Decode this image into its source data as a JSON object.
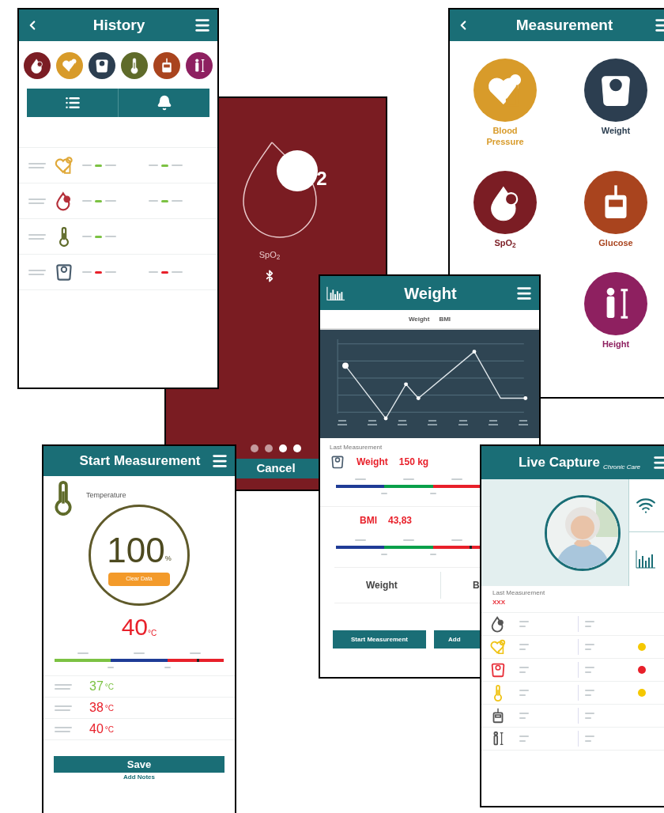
{
  "history": {
    "title": "History",
    "categories": [
      {
        "kind": "spo2",
        "color": "#7b1d24"
      },
      {
        "kind": "blood_pressure",
        "color": "#d89b2a"
      },
      {
        "kind": "weight",
        "color": "#2c3e50"
      },
      {
        "kind": "temperature",
        "color": "#5f6b2a"
      },
      {
        "kind": "glucose",
        "color": "#a9441e"
      },
      {
        "kind": "height",
        "color": "#8e2060"
      }
    ],
    "tabs": [
      {
        "kind": "list"
      },
      {
        "kind": "bell"
      }
    ],
    "rows": [
      {
        "kind": "blood_pressure",
        "icon": {
          "color": "#e0a93a"
        },
        "values": [
          {
            "color": "#7cc243"
          },
          {
            "color": "#7cc243"
          }
        ]
      },
      {
        "kind": "spo2",
        "icon": {
          "color": "#b5303a"
        },
        "values": [
          {
            "color": "#7cc243"
          },
          {
            "color": "#7cc243"
          }
        ]
      },
      {
        "kind": "temperature",
        "icon": {
          "color": "#5f6b2a"
        },
        "values": [
          {
            "color": "#7cc243"
          }
        ]
      },
      {
        "kind": "weight",
        "icon": {
          "color": "#4a5d6e"
        },
        "values": [
          {
            "color": "#e8202a"
          },
          {
            "color": "#e8202a"
          }
        ]
      }
    ]
  },
  "spo2": {
    "subscript": "2",
    "label": "SpO$_{2}$",
    "dots": [
      {
        "filled": false
      },
      {
        "filled": false
      },
      {
        "filled": true
      },
      {
        "filled": true
      }
    ],
    "cancel": "Cancel"
  },
  "measurement": {
    "title": "Measurement",
    "items": [
      {
        "kind": "blood_pressure",
        "label": "Blood Pressure",
        "color": "#d89b2a"
      },
      {
        "kind": "weight",
        "label": "Weight",
        "color": "#2c3e50"
      },
      {
        "kind": "spo2",
        "label": "SpO$_{2}$",
        "color": "#7b1d24"
      },
      {
        "kind": "glucose",
        "label": "Glucose",
        "color": "#a9441e"
      },
      {
        "kind": "height",
        "label": "Height",
        "color": "#8e2060"
      }
    ]
  },
  "weight": {
    "title": "Weight",
    "tabs": [
      "Weight",
      "BMI"
    ],
    "last_measurement": "Last Measurement",
    "weight_label": "Weight",
    "weight_value": "150 kg",
    "weight_scale": [
      {
        "color": "#1f3c96"
      },
      {
        "color": "#0aa04a"
      },
      {
        "color": "#e8202a"
      }
    ],
    "bmi_label": "BMI",
    "bmi_value": "43,83",
    "bmi_scale": [
      {
        "color": "#1f3c96"
      },
      {
        "color": "#0aa04a"
      },
      {
        "color": "#e8202a"
      }
    ],
    "bmi_marker": {
      "level": 0.92
    },
    "bottom_tabs": [
      "Weight",
      "B"
    ],
    "buttons": [
      "Start Measurement",
      "Add"
    ]
  },
  "start": {
    "title": "Start Measurement",
    "sensor": "Temperature",
    "progress": "100",
    "progress_unit": "%",
    "clear": "Clear Data",
    "reading": "40",
    "reading_unit": "°C",
    "scale": [
      {
        "color": "#7cc243"
      },
      {
        "color": "#1f3c96"
      },
      {
        "color": "#e8202a"
      }
    ],
    "marker": {
      "level": 0.84
    },
    "history": [
      {
        "value": "37",
        "unit": "°C",
        "color": "#7cc243"
      },
      {
        "value": "38",
        "unit": "°C",
        "color": "#e8202a"
      },
      {
        "value": "40",
        "unit": "°C",
        "color": "#e8202a"
      }
    ],
    "save": "Save",
    "notes": "Add Notes"
  },
  "live": {
    "title": "Live Capture",
    "logo": "Chronic Care",
    "last_measurement": "Last Measurement",
    "last_value": "XXX",
    "rows": [
      {
        "kind": "spo2",
        "icon": {
          "color": "#555555"
        }
      },
      {
        "kind": "blood_pressure",
        "icon": {
          "color": "#f0c419"
        },
        "color": "#f5c800"
      },
      {
        "kind": "weight",
        "icon": {
          "color": "#e8303a"
        },
        "color": "#e8202a"
      },
      {
        "kind": "temperature",
        "icon": {
          "color": "#f0c419"
        },
        "color": "#f5c800"
      },
      {
        "kind": "glucose",
        "icon": {
          "color": "#555555"
        }
      },
      {
        "kind": "height",
        "icon": {
          "color": "#555555"
        }
      }
    ]
  }
}
